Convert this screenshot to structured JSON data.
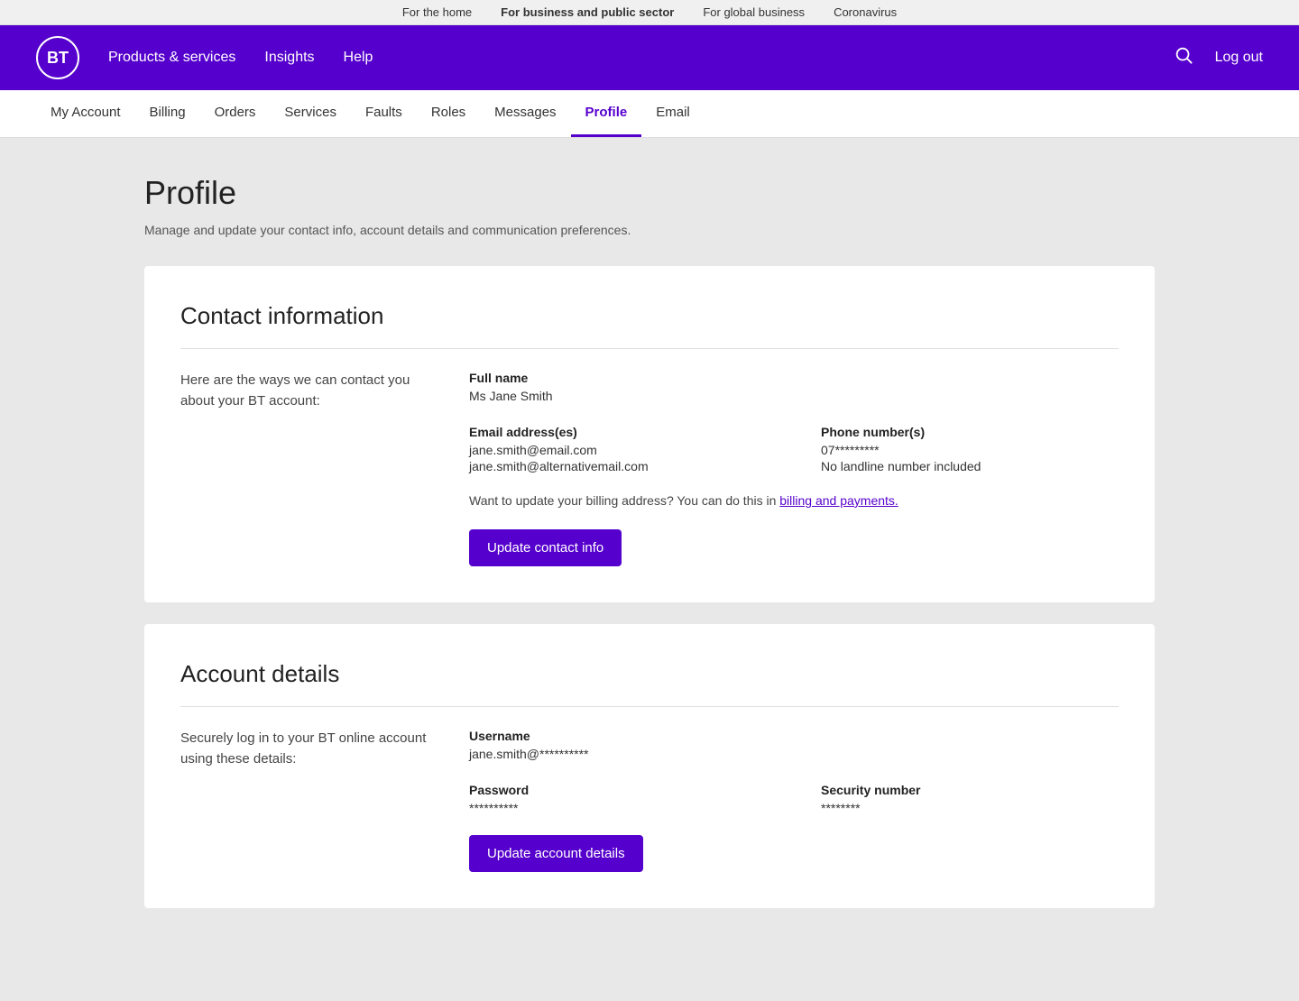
{
  "topBar": {
    "links": [
      {
        "label": "For the home",
        "active": false
      },
      {
        "label": "For business and public sector",
        "active": true
      },
      {
        "label": "For global business",
        "active": false
      },
      {
        "label": "Coronavirus",
        "active": false
      }
    ]
  },
  "header": {
    "logo": "BT",
    "nav": [
      {
        "label": "Products & services"
      },
      {
        "label": "Insights"
      },
      {
        "label": "Help"
      }
    ],
    "search_label": "Search",
    "logout_label": "Log out"
  },
  "subNav": {
    "items": [
      {
        "label": "My Account",
        "active": false
      },
      {
        "label": "Billing",
        "active": false
      },
      {
        "label": "Orders",
        "active": false
      },
      {
        "label": "Services",
        "active": false
      },
      {
        "label": "Faults",
        "active": false
      },
      {
        "label": "Roles",
        "active": false
      },
      {
        "label": "Messages",
        "active": false
      },
      {
        "label": "Profile",
        "active": true
      },
      {
        "label": "Email",
        "active": false
      }
    ]
  },
  "page": {
    "title": "Profile",
    "subtitle": "Manage and update your contact info, account details and communication preferences."
  },
  "contactInfo": {
    "card_title": "Contact information",
    "description": "Here are the ways we can contact you about your BT account:",
    "full_name_label": "Full name",
    "full_name_value": "Ms Jane Smith",
    "email_label": "Email address(es)",
    "email_1": "jane.smith@email.com",
    "email_2": "jane.smith@alternativemail.com",
    "phone_label": "Phone number(s)",
    "phone_value": "07*********",
    "landline_value": "No landline number included",
    "billing_note": "Want to update your billing address? You can do this in ",
    "billing_link_text": "billing and payments.",
    "update_btn": "Update contact info"
  },
  "accountDetails": {
    "card_title": "Account details",
    "description": "Securely log in to your BT online account using these details:",
    "username_label": "Username",
    "username_value": "jane.smith@**********",
    "password_label": "Password",
    "password_value": "**********",
    "security_label": "Security number",
    "security_value": "********",
    "update_btn": "Update account details"
  },
  "colors": {
    "brand_purple": "#5500cc",
    "active_nav": "#5500cc"
  }
}
